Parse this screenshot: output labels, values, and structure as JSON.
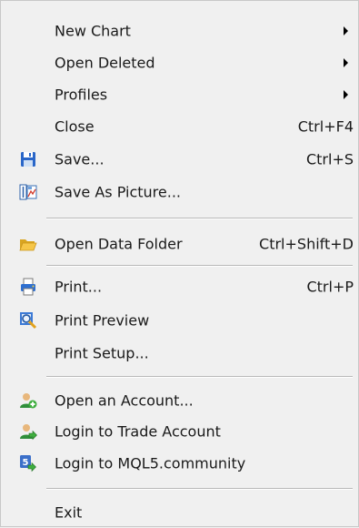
{
  "menu": {
    "new_chart": {
      "label": "New Chart"
    },
    "open_deleted": {
      "label": "Open Deleted"
    },
    "profiles": {
      "label": "Profiles"
    },
    "close": {
      "label": "Close",
      "shortcut": "Ctrl+F4"
    },
    "save": {
      "label": "Save...",
      "shortcut": "Ctrl+S",
      "icon": "floppy-disk-icon"
    },
    "save_as_picture": {
      "label": "Save As Picture...",
      "icon": "picture-icon"
    },
    "open_data_folder": {
      "label": "Open Data Folder",
      "shortcut": "Ctrl+Shift+D",
      "icon": "folder-icon"
    },
    "print": {
      "label": "Print...",
      "shortcut": "Ctrl+P",
      "icon": "printer-icon"
    },
    "print_preview": {
      "label": "Print Preview",
      "icon": "print-preview-icon"
    },
    "print_setup": {
      "label": "Print Setup..."
    },
    "open_account": {
      "label": "Open an Account...",
      "icon": "user-add-icon"
    },
    "login_trade": {
      "label": "Login to Trade Account",
      "icon": "user-login-icon"
    },
    "login_mql5": {
      "label": "Login to MQL5.community",
      "icon": "mql5-login-icon"
    },
    "exit": {
      "label": "Exit"
    }
  }
}
